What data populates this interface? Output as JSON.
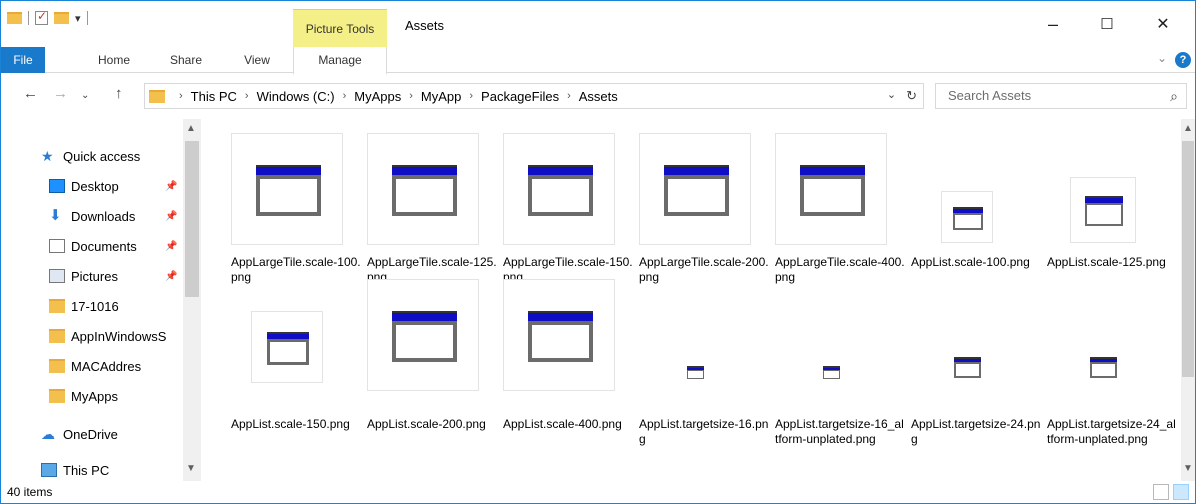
{
  "window": {
    "title": "Assets",
    "context_tab_label": "Picture Tools",
    "controls": {
      "minimize": "–",
      "maximize": "☐",
      "close": "✕"
    }
  },
  "ribbon": {
    "tabs": [
      "File",
      "Home",
      "Share",
      "View",
      "Manage"
    ],
    "help": "?",
    "collapse": "⌄"
  },
  "address": {
    "crumbs": [
      "This PC",
      "Windows (C:)",
      "MyApps",
      "MyApp",
      "PackageFiles",
      "Assets"
    ],
    "search_placeholder": "Search Assets"
  },
  "nav": {
    "items": [
      {
        "label": "Quick access",
        "icon": "star-icon",
        "pinned": false
      },
      {
        "label": "Desktop",
        "icon": "desktop-icon",
        "pinned": true
      },
      {
        "label": "Downloads",
        "icon": "download-arrow-icon",
        "pinned": true
      },
      {
        "label": "Documents",
        "icon": "document-icon",
        "pinned": true
      },
      {
        "label": "Pictures",
        "icon": "pictures-icon",
        "pinned": true
      },
      {
        "label": "17-1016",
        "icon": "folder-icon",
        "pinned": false
      },
      {
        "label": "AppInWindowsS",
        "icon": "folder-icon",
        "pinned": false
      },
      {
        "label": "MACAddres",
        "icon": "folder-icon",
        "pinned": false
      },
      {
        "label": "MyApps",
        "icon": "folder-icon",
        "pinned": false
      },
      {
        "label": "OneDrive",
        "icon": "onedrive-icon",
        "pinned": false
      },
      {
        "label": "This PC",
        "icon": "pc-icon",
        "pinned": false
      }
    ]
  },
  "files": [
    {
      "name": "AppLargeTile.scale-100.png"
    },
    {
      "name": "AppLargeTile.scale-125.png"
    },
    {
      "name": "AppLargeTile.scale-150.png"
    },
    {
      "name": "AppLargeTile.scale-200.png"
    },
    {
      "name": "AppLargeTile.scale-400.png"
    },
    {
      "name": "AppList.scale-100.png"
    },
    {
      "name": "AppList.scale-125.png"
    },
    {
      "name": "AppList.scale-150.png"
    },
    {
      "name": "AppList.scale-200.png"
    },
    {
      "name": "AppList.scale-400.png"
    },
    {
      "name": "AppList.targetsize-16.png"
    },
    {
      "name": "AppList.targetsize-16_altform-unplated.png"
    },
    {
      "name": "AppList.targetsize-24.png"
    },
    {
      "name": "AppList.targetsize-24_altform-unplated.png"
    }
  ],
  "status": {
    "count": "40 items"
  },
  "colors": {
    "accent": "#1979ca",
    "context_tab": "#f4ef87",
    "folder": "#f4c04d",
    "tile_bar": "#0f0ec4"
  }
}
